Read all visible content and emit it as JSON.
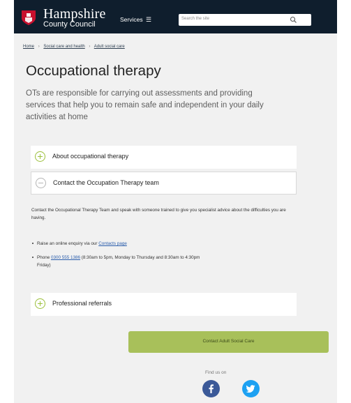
{
  "header": {
    "logo_line1": "Hampshire",
    "logo_line2": "County Council",
    "services_label": "Services",
    "menu_glyph": "☰",
    "search_placeholder": "Search the site",
    "colors": {
      "header_bg": "#0f1e2d",
      "crest": "#c8102e",
      "accent_green": "#9bbf3a"
    }
  },
  "breadcrumb": [
    {
      "label": "Home"
    },
    {
      "label": "Social care and health"
    },
    {
      "label": "Adult social care"
    }
  ],
  "breadcrumb_separator": "›",
  "page": {
    "title": "Occupational therapy",
    "lead": "OTs are responsible for carrying out assessments and providing services that help you to remain safe and independent in your daily activities at home"
  },
  "accordion": [
    {
      "label": "About occupational therapy",
      "state": "collapsed",
      "icon": "plus-circle-icon"
    },
    {
      "label": "Contact the Occupation Therapy team",
      "state": "expanded",
      "icon": "minus-circle-icon"
    },
    {
      "label": "Professional referrals",
      "state": "collapsed",
      "icon": "plus-circle-icon"
    }
  ],
  "contact_section": {
    "intro": "Contact the Occupational Therapy Team and speak with someone trained to give you specialist advice about the difficulties you are having.",
    "bullet1_prefix": "Raise an online enquiry via our",
    "bullet1_link": "Contacts page",
    "bullet2_prefix": "Phone",
    "bullet2_phone": "0300 555 1386",
    "bullet2_suffix": "(8:30am to 5pm, Monday to Thursday and 8:30am to 4:30pm",
    "bullet2_suffix2": "Friday)"
  },
  "cta": {
    "label": "Contact Adult Social Care"
  },
  "footer": {
    "find_us": "Find us on",
    "social": [
      {
        "icon": "facebook-icon"
      },
      {
        "icon": "twitter-icon"
      }
    ]
  }
}
